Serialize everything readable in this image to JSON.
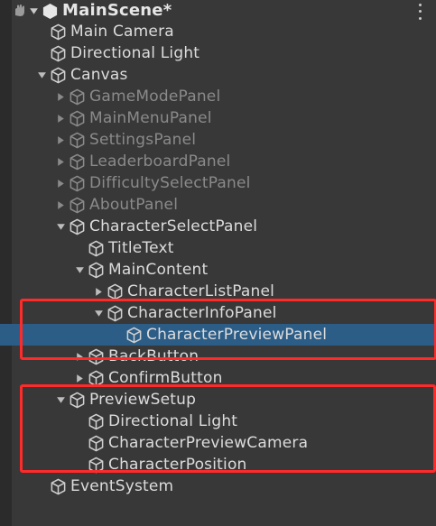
{
  "scene": {
    "title": "MainScene*"
  },
  "rows": [
    {
      "label": "Main Camera",
      "depth": 1,
      "toggle": "none",
      "dim": false
    },
    {
      "label": "Directional Light",
      "depth": 1,
      "toggle": "none",
      "dim": false
    },
    {
      "label": "Canvas",
      "depth": 1,
      "toggle": "expanded",
      "dim": false
    },
    {
      "label": "GameModePanel",
      "depth": 2,
      "toggle": "collapsed",
      "dim": true
    },
    {
      "label": "MainMenuPanel",
      "depth": 2,
      "toggle": "collapsed",
      "dim": true
    },
    {
      "label": "SettingsPanel",
      "depth": 2,
      "toggle": "collapsed",
      "dim": true
    },
    {
      "label": "LeaderboardPanel",
      "depth": 2,
      "toggle": "collapsed",
      "dim": true
    },
    {
      "label": "DifficultySelectPanel",
      "depth": 2,
      "toggle": "collapsed",
      "dim": true
    },
    {
      "label": "AboutPanel",
      "depth": 2,
      "toggle": "collapsed",
      "dim": true
    },
    {
      "label": "CharacterSelectPanel",
      "depth": 2,
      "toggle": "expanded",
      "dim": false
    },
    {
      "label": "TitleText",
      "depth": 3,
      "toggle": "none",
      "dim": false
    },
    {
      "label": "MainContent",
      "depth": 3,
      "toggle": "expanded",
      "dim": false
    },
    {
      "label": "CharacterListPanel",
      "depth": 4,
      "toggle": "collapsed",
      "dim": false
    },
    {
      "label": "CharacterInfoPanel",
      "depth": 4,
      "toggle": "expanded",
      "dim": false
    },
    {
      "label": "CharacterPreviewPanel",
      "depth": 5,
      "toggle": "none",
      "dim": false,
      "selected": true
    },
    {
      "label": "BackButton",
      "depth": 3,
      "toggle": "collapsed",
      "dim": false
    },
    {
      "label": "ConfirmButton",
      "depth": 3,
      "toggle": "collapsed",
      "dim": false
    },
    {
      "label": "PreviewSetup",
      "depth": 2,
      "toggle": "expanded",
      "dim": false
    },
    {
      "label": "Directional Light",
      "depth": 3,
      "toggle": "none",
      "dim": false
    },
    {
      "label": "CharacterPreviewCamera",
      "depth": 3,
      "toggle": "none",
      "dim": false
    },
    {
      "label": "CharacterPosition",
      "depth": 3,
      "toggle": "none",
      "dim": false
    },
    {
      "label": "EventSystem",
      "depth": 1,
      "toggle": "none",
      "dim": false
    }
  ],
  "icons": {
    "gameobject": "cube-icon",
    "scene": "unity-scene-icon",
    "menu": "kebab-menu-icon"
  },
  "colors": {
    "background": "#383838",
    "selection": "#2c5d87",
    "highlight_box": "#ff2a2a",
    "text": "#dcdcdc",
    "dim_text": "#8a8a8a"
  }
}
